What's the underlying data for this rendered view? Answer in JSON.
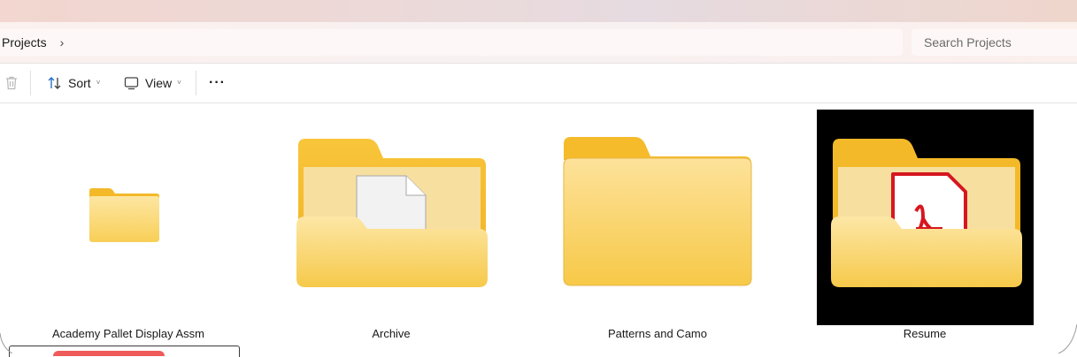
{
  "address": {
    "crumb": "Projects",
    "chevron": "›"
  },
  "search": {
    "placeholder": "Search Projects"
  },
  "toolbar": {
    "delete_icon": "trash-icon",
    "sort_label": "Sort",
    "view_label": "View",
    "more_label": "···"
  },
  "folders": [
    {
      "name": "Academy Pallet Display Assm",
      "icon": "small-folder"
    },
    {
      "name": "Archive",
      "icon": "folder-with-document"
    },
    {
      "name": "Patterns and Camo",
      "icon": "folder"
    },
    {
      "name": "Resume",
      "icon": "folder-with-pdf"
    }
  ],
  "colors": {
    "folder_back": "#f6c23e",
    "folder_front": "#fcd978",
    "pdf_red": "#d6171f"
  }
}
